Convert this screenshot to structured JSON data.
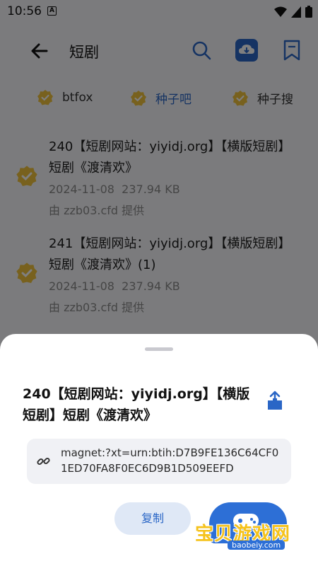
{
  "status": {
    "time": "10:56",
    "notif_letter": "A"
  },
  "header": {
    "title": "短剧"
  },
  "tabs": [
    {
      "label": "btfox"
    },
    {
      "label": "种子吧"
    },
    {
      "label": "种子搜"
    }
  ],
  "results": [
    {
      "name": "240【短剧网站：yiyidj.org】【横版短剧】短剧《渡清欢》",
      "date": "2024-11-08",
      "size": "237.94 KB",
      "source": "由 zzb03.cfd 提供"
    },
    {
      "name": "241【短剧网站：yiyidj.org】【横版短剧】短剧《渡清欢》(1)",
      "date": "2024-11-08",
      "size": "237.94 KB",
      "source": "由 zzb03.cfd 提供"
    }
  ],
  "sheet": {
    "title": "240【短剧网站：yiyidj.org】【横版短剧】短剧《渡清欢》",
    "magnet": "magnet:?xt=urn:btih:D7B9FE136C64CF01ED70FA8F0EC6D9B1D509EEFD",
    "copy_label": "复制"
  },
  "watermark": {
    "text": "宝贝游戏网",
    "url": "baobeiy.com"
  },
  "colors": {
    "accent": "#2a66c6",
    "badge": "#f0c33c",
    "sheet_bg": "#ffffff"
  }
}
